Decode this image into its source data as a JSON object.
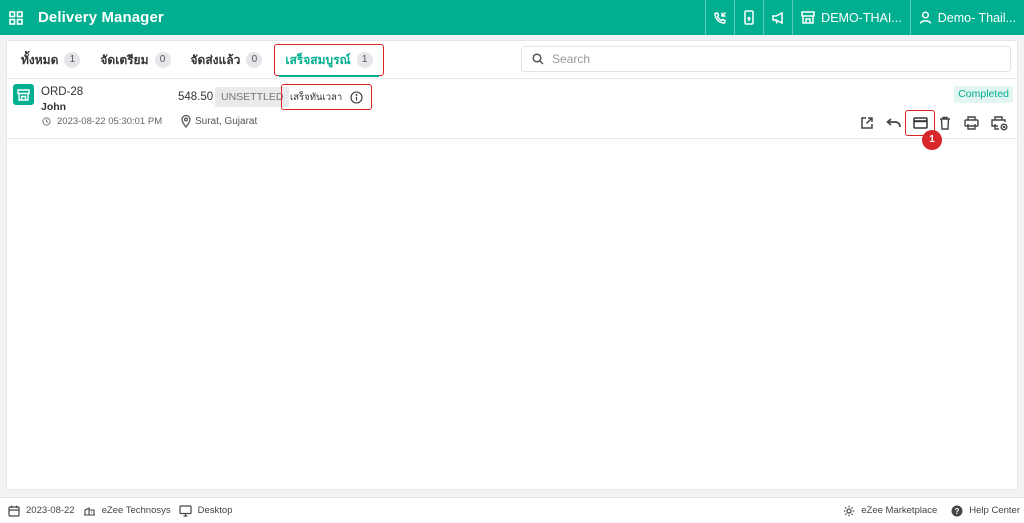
{
  "header": {
    "title": "Delivery Manager",
    "property_label": "DEMO-THAI...",
    "user_label": "Demo- Thail..."
  },
  "tabs": [
    {
      "label": "ทั้งหมด",
      "count": "1"
    },
    {
      "label": "จัดเตรียม",
      "count": "0"
    },
    {
      "label": "จัดส่งแล้ว",
      "count": "0"
    },
    {
      "label": "เสร็จสมบูรณ์",
      "count": "1"
    }
  ],
  "active_tab_index": 3,
  "search": {
    "placeholder": "Search",
    "value": ""
  },
  "order": {
    "id": "ORD-28",
    "customer": "John",
    "timestamp": "2023-08-22 05:30:01 PM",
    "amount": "548.50",
    "payment_status": "UNSETTLED",
    "delivery_status": "เสร็จทันเวลา",
    "location": "Surat, Gujarat",
    "status": "Completed",
    "actions": [
      "open-icon",
      "undo-icon",
      "card-icon",
      "delete-icon",
      "print-icon",
      "print-settings-icon"
    ]
  },
  "annotation": {
    "step_badge": "1"
  },
  "footer": {
    "date": "2023-08-22",
    "company": "eZee Technosys",
    "device": "Desktop",
    "marketplace": "eZee Marketplace",
    "help": "Help Center"
  },
  "colors": {
    "brand": "#00ae90",
    "highlight": "#e02424",
    "badge": "#d62828"
  }
}
